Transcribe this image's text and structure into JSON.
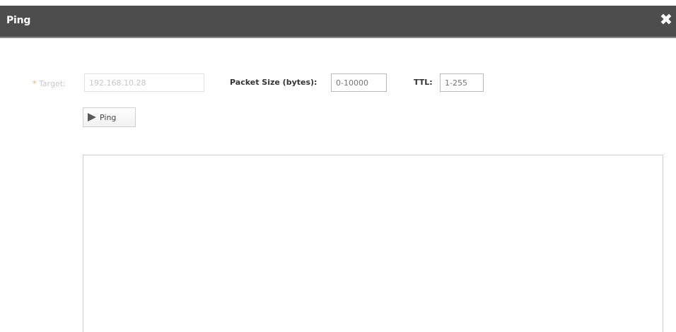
{
  "dialog": {
    "title": "Ping",
    "close_glyph": "✖",
    "close_icon": "close-icon"
  },
  "form": {
    "target": {
      "required_marker": "*",
      "label": "Target:",
      "value": "192.168.10.28"
    },
    "packet_size": {
      "label": "Packet Size (bytes):",
      "placeholder": "0-10000"
    },
    "ttl": {
      "label": "TTL:",
      "placeholder": "1-255"
    },
    "ping_button": {
      "label": "Ping",
      "icon": "play-icon"
    }
  },
  "output": {
    "text": ""
  },
  "colors": {
    "titlebar": "#4d4d4d",
    "required_marker": "#e3b85c"
  }
}
